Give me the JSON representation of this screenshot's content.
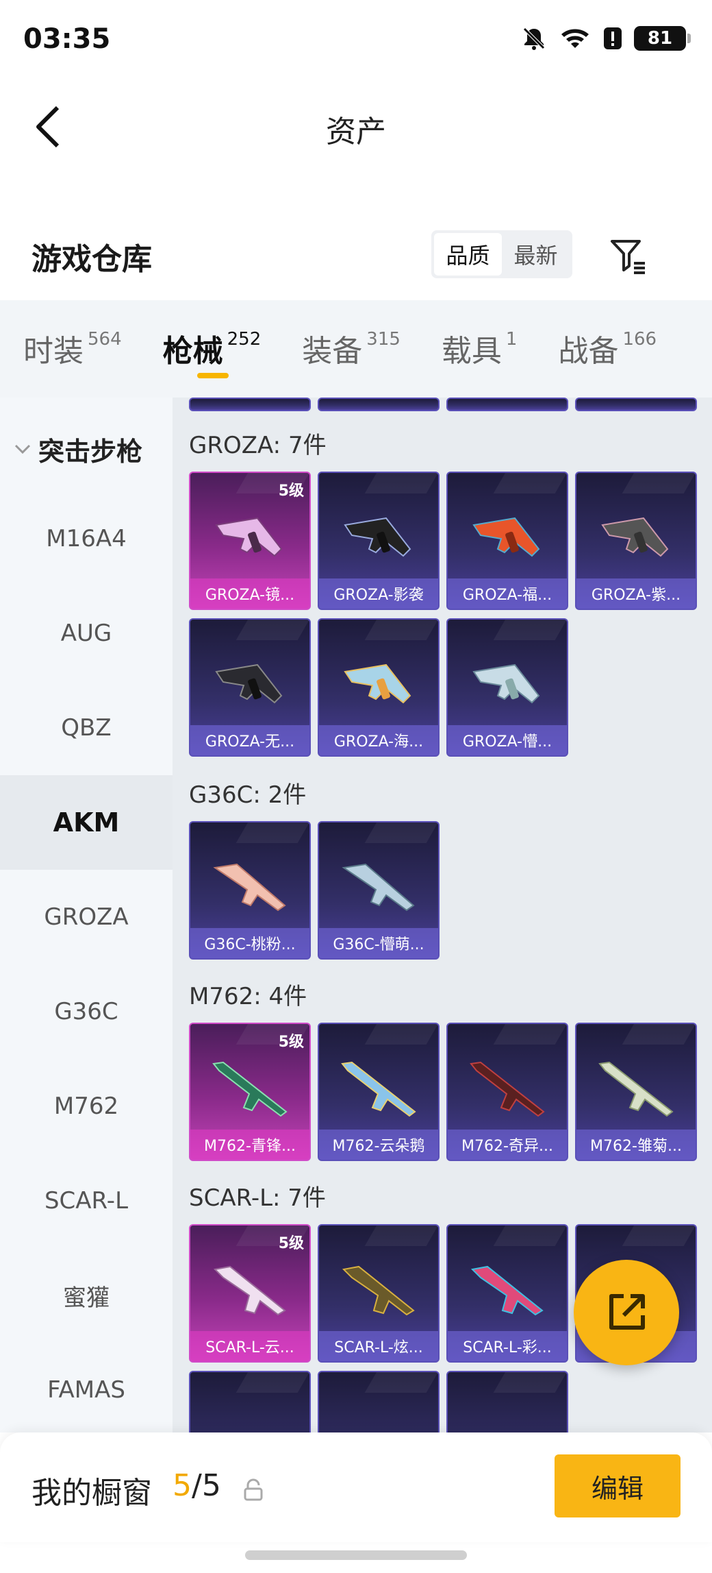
{
  "status": {
    "time": "03:35",
    "battery": "81"
  },
  "nav": {
    "title": "资产"
  },
  "warehouse": {
    "title": "游戏仓库",
    "sort": [
      "品质",
      "最新"
    ],
    "sort_active": 0
  },
  "tabs": [
    {
      "label": "时装",
      "count": "564"
    },
    {
      "label": "枪械",
      "count": "252"
    },
    {
      "label": "装备",
      "count": "315"
    },
    {
      "label": "载具",
      "count": "1"
    },
    {
      "label": "战备",
      "count": "166"
    }
  ],
  "sidebar": {
    "group": "突击步枪",
    "items": [
      "M16A4",
      "AUG",
      "QBZ",
      "AKM",
      "GROZA",
      "G36C",
      "M762",
      "SCAR-L",
      "蜜獾",
      "FAMAS"
    ],
    "active": "AKM"
  },
  "sections": [
    {
      "title": "GROZA: 7件",
      "cards": [
        {
          "name": "GROZA-镜...",
          "level": "5级"
        },
        {
          "name": "GROZA-影袭"
        },
        {
          "name": "GROZA-福..."
        },
        {
          "name": "GROZA-紫..."
        },
        {
          "name": "GROZA-无..."
        },
        {
          "name": "GROZA-海..."
        },
        {
          "name": "GROZA-懵..."
        }
      ]
    },
    {
      "title": "G36C: 2件",
      "cards": [
        {
          "name": "G36C-桃粉..."
        },
        {
          "name": "G36C-懵萌..."
        }
      ]
    },
    {
      "title": "M762: 4件",
      "cards": [
        {
          "name": "M762-青锋...",
          "level": "5级"
        },
        {
          "name": "M762-云朵鹅"
        },
        {
          "name": "M762-奇异..."
        },
        {
          "name": "M762-雏菊..."
        }
      ]
    },
    {
      "title": "SCAR-L: 7件",
      "cards": [
        {
          "name": "SCAR-L-云...",
          "level": "5级"
        },
        {
          "name": "SCAR-L-炫..."
        },
        {
          "name": "SCAR-L-彩..."
        },
        {
          "name": "..."
        }
      ]
    }
  ],
  "showcase": {
    "title": "我的橱窗",
    "current": "5",
    "total": "/5",
    "edit": "编辑"
  },
  "colors": {
    "accent": "#f9b514",
    "tier5": "#c444b8",
    "tier4": "#4a3f9a"
  },
  "icons": [
    "mute-icon",
    "wifi-icon",
    "alert-icon",
    "back-arrow-icon",
    "filter-icon",
    "chevron-down-icon",
    "lock-icon",
    "share-export-icon"
  ]
}
